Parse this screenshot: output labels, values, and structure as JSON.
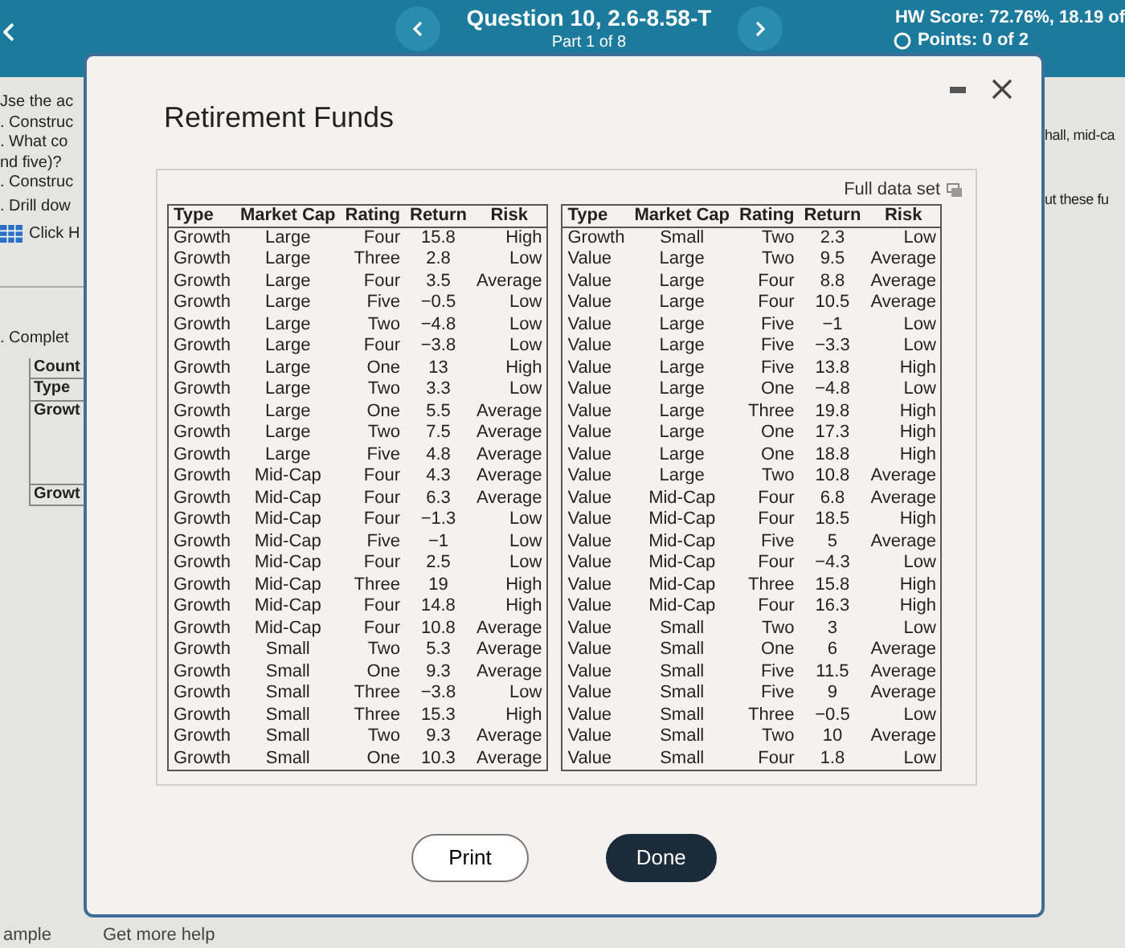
{
  "header": {
    "title": "Question 10, 2.6-8.58-T",
    "subtitle": "Part 1 of 8",
    "score": "HW Score: 72.76%, 18.19 of",
    "points": "Points: 0 of 2"
  },
  "background_left": {
    "lines": [
      "Jse the ac",
      ". Construc",
      ". What co",
      "nd five)?",
      ". Construc",
      ". Drill dow"
    ],
    "link": "Click H",
    "section": ". Complet",
    "mini_table": [
      "Count",
      "Type",
      "Growt",
      "Growt"
    ],
    "footer": "ample"
  },
  "background_right": {
    "lines": [
      "hall, mid-ca",
      "ut these fu"
    ]
  },
  "footer_link": "Get more help",
  "dialog": {
    "title": "Retirement Funds",
    "full_data_link": "Full data set",
    "tables": [
      {
        "columns": [
          "Type",
          "Market Cap",
          "Rating",
          "Return",
          "Risk"
        ],
        "rows": [
          [
            "Growth",
            "Large",
            "Four",
            "15.8",
            "High"
          ],
          [
            "Growth",
            "Large",
            "Three",
            "2.8",
            "Low"
          ],
          [
            "Growth",
            "Large",
            "Four",
            "3.5",
            "Average"
          ],
          [
            "Growth",
            "Large",
            "Five",
            "−0.5",
            "Low"
          ],
          [
            "Growth",
            "Large",
            "Two",
            "−4.8",
            "Low"
          ],
          [
            "Growth",
            "Large",
            "Four",
            "−3.8",
            "Low"
          ],
          [
            "Growth",
            "Large",
            "One",
            "13",
            "High"
          ],
          [
            "Growth",
            "Large",
            "Two",
            "3.3",
            "Low"
          ],
          [
            "Growth",
            "Large",
            "One",
            "5.5",
            "Average"
          ],
          [
            "Growth",
            "Large",
            "Two",
            "7.5",
            "Average"
          ],
          [
            "Growth",
            "Large",
            "Five",
            "4.8",
            "Average"
          ],
          [
            "Growth",
            "Mid-Cap",
            "Four",
            "4.3",
            "Average"
          ],
          [
            "Growth",
            "Mid-Cap",
            "Four",
            "6.3",
            "Average"
          ],
          [
            "Growth",
            "Mid-Cap",
            "Four",
            "−1.3",
            "Low"
          ],
          [
            "Growth",
            "Mid-Cap",
            "Five",
            "−1",
            "Low"
          ],
          [
            "Growth",
            "Mid-Cap",
            "Four",
            "2.5",
            "Low"
          ],
          [
            "Growth",
            "Mid-Cap",
            "Three",
            "19",
            "High"
          ],
          [
            "Growth",
            "Mid-Cap",
            "Four",
            "14.8",
            "High"
          ],
          [
            "Growth",
            "Mid-Cap",
            "Four",
            "10.8",
            "Average"
          ],
          [
            "Growth",
            "Small",
            "Two",
            "5.3",
            "Average"
          ],
          [
            "Growth",
            "Small",
            "One",
            "9.3",
            "Average"
          ],
          [
            "Growth",
            "Small",
            "Three",
            "−3.8",
            "Low"
          ],
          [
            "Growth",
            "Small",
            "Three",
            "15.3",
            "High"
          ],
          [
            "Growth",
            "Small",
            "Two",
            "9.3",
            "Average"
          ],
          [
            "Growth",
            "Small",
            "One",
            "10.3",
            "Average"
          ]
        ]
      },
      {
        "columns": [
          "Type",
          "Market Cap",
          "Rating",
          "Return",
          "Risk"
        ],
        "rows": [
          [
            "Growth",
            "Small",
            "Two",
            "2.3",
            "Low"
          ],
          [
            "Value",
            "Large",
            "Two",
            "9.5",
            "Average"
          ],
          [
            "Value",
            "Large",
            "Four",
            "8.8",
            "Average"
          ],
          [
            "Value",
            "Large",
            "Four",
            "10.5",
            "Average"
          ],
          [
            "Value",
            "Large",
            "Five",
            "−1",
            "Low"
          ],
          [
            "Value",
            "Large",
            "Five",
            "−3.3",
            "Low"
          ],
          [
            "Value",
            "Large",
            "Five",
            "13.8",
            "High"
          ],
          [
            "Value",
            "Large",
            "One",
            "−4.8",
            "Low"
          ],
          [
            "Value",
            "Large",
            "Three",
            "19.8",
            "High"
          ],
          [
            "Value",
            "Large",
            "One",
            "17.3",
            "High"
          ],
          [
            "Value",
            "Large",
            "One",
            "18.8",
            "High"
          ],
          [
            "Value",
            "Large",
            "Two",
            "10.8",
            "Average"
          ],
          [
            "Value",
            "Mid-Cap",
            "Four",
            "6.8",
            "Average"
          ],
          [
            "Value",
            "Mid-Cap",
            "Four",
            "18.5",
            "High"
          ],
          [
            "Value",
            "Mid-Cap",
            "Five",
            "5",
            "Average"
          ],
          [
            "Value",
            "Mid-Cap",
            "Four",
            "−4.3",
            "Low"
          ],
          [
            "Value",
            "Mid-Cap",
            "Three",
            "15.8",
            "High"
          ],
          [
            "Value",
            "Mid-Cap",
            "Four",
            "16.3",
            "High"
          ],
          [
            "Value",
            "Small",
            "Two",
            "3",
            "Low"
          ],
          [
            "Value",
            "Small",
            "One",
            "6",
            "Average"
          ],
          [
            "Value",
            "Small",
            "Five",
            "11.5",
            "Average"
          ],
          [
            "Value",
            "Small",
            "Five",
            "9",
            "Average"
          ],
          [
            "Value",
            "Small",
            "Three",
            "−0.5",
            "Low"
          ],
          [
            "Value",
            "Small",
            "Two",
            "10",
            "Average"
          ],
          [
            "Value",
            "Small",
            "Four",
            "1.8",
            "Low"
          ]
        ]
      }
    ],
    "buttons": [
      {
        "label": "Print",
        "kind": "outline"
      },
      {
        "label": "Done",
        "kind": "primary"
      }
    ]
  }
}
